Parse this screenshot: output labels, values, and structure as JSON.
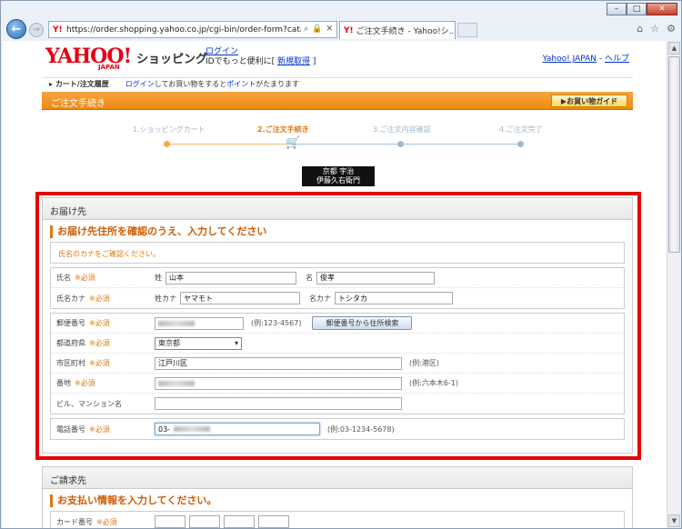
{
  "browser": {
    "url": "https://order.shopping.yahoo.co.jp/cgi-bin/order-form?catalo",
    "tab_title": "ご注文手続き - Yahoo!シ...",
    "favicon": "Y!"
  },
  "header": {
    "logo": "YAHOO!",
    "logo_sub": "JAPAN",
    "shop_name": "ショッピング",
    "login_link": "ログイン",
    "login_text_prefix": "IDでもっと便利に[",
    "register_link": "新規取得",
    "login_text_suffix": "]",
    "yahoo_japan_link": "Yahoo! JAPAN",
    "separator": " - ",
    "help_link": "ヘルプ"
  },
  "crumb": {
    "cart_history": "カート/注文履歴",
    "login_link": "ログイン",
    "middle_text": "してお買い物をするとポイントがたまります",
    "point_link": "ポイント"
  },
  "orange_bar": {
    "title": "ご注文手続き",
    "guide_button": "お買い物ガイド"
  },
  "steps": [
    {
      "label": "1.ショッピングカート",
      "active": false
    },
    {
      "label": "2.ご注文手続き",
      "active": true
    },
    {
      "label": "3.ご注文内容確認",
      "active": false
    },
    {
      "label": "4.ご注文完了",
      "active": false
    }
  ],
  "shop_logo": {
    "line1": "京都 宇治",
    "line2": "伊藤久右衛門"
  },
  "delivery": {
    "panel_title": "お届け先",
    "section_title": "お届け先住所を確認のうえ、入力してください",
    "notice": "氏名のカナをご確認ください。",
    "required": "※必須",
    "name_label": "氏名",
    "last_name_prefix": "姓",
    "last_name_value": "山本",
    "first_name_prefix": "名",
    "first_name_value": "俊孝",
    "kana_label": "氏名カナ",
    "last_kana_prefix": "姓カナ",
    "last_kana_value": "ヤマモト",
    "first_kana_prefix": "名カナ",
    "first_kana_value": "トシタカ",
    "zip_label": "郵便番号",
    "zip_hint": "(例:123-4567)",
    "zip_button": "郵便番号から住所検索",
    "pref_label": "都道府県",
    "pref_value": "東京都",
    "city_label": "市区町村",
    "city_value": "江戸川区",
    "city_hint": "(例:港区)",
    "street_label": "番地",
    "street_hint": "(例:六本木6-1)",
    "building_label": "ビル、マンション名",
    "phone_label": "電話番号",
    "phone_value": "03-",
    "phone_hint": "(例:03-1234-5678)"
  },
  "billing": {
    "panel_title": "ご請求先",
    "section_title": "お支払い情報を入力してください。",
    "card_label": "カード番号",
    "required": "※必須"
  }
}
